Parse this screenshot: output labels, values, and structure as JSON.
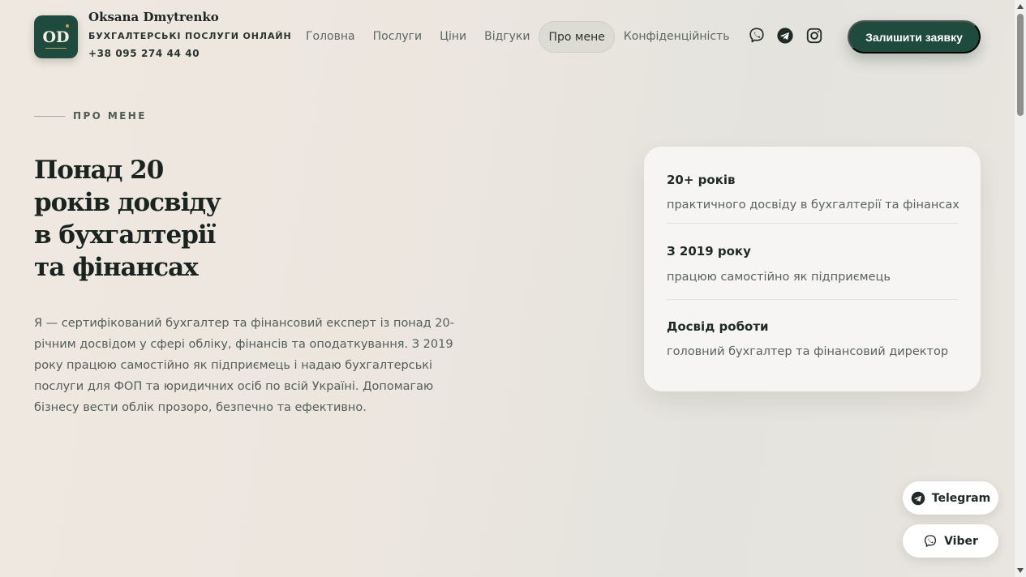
{
  "header": {
    "logo_text": "OD",
    "brand_name": "Oksana Dmytrenko",
    "brand_subtitle": "БУХГАЛТЕРСЬКІ ПОСЛУГИ ОНЛАЙН",
    "phone": "+38 095 274 44 40",
    "nav": [
      {
        "label": "Головна"
      },
      {
        "label": "Послуги"
      },
      {
        "label": "Ціни"
      },
      {
        "label": "Відгуки"
      },
      {
        "label": "Про мене",
        "active": true
      },
      {
        "label": "Конфіденційність"
      }
    ],
    "social_icons": [
      "viber-icon",
      "telegram-icon",
      "instagram-icon"
    ],
    "cta_label": "Залишити заявку"
  },
  "about": {
    "eyebrow": "ПРО МЕНЕ",
    "heading_lines": [
      "Понад 20",
      "років досвіду",
      "в бухгалтерії",
      "та фінансах"
    ],
    "paragraph": "Я — сертифікований бухгалтер та фінансовий експерт із понад 20-річним досвідом у сфері обліку, фінансів та оподаткування. З 2019 року працюю самостійно як підприємець і надаю бухгалтерські послуги для ФОП та юридичних осіб по всій Україні. Допомагаю бізнесу вести облік прозоро, безпечно та ефективно."
  },
  "stats": [
    {
      "title": "20+ років",
      "desc": "практичного досвіду в бухгалтерії та фінансах"
    },
    {
      "title": "З 2019 року",
      "desc": "працюю самостійно як підприємець"
    },
    {
      "title": "Досвід роботи",
      "desc": "головний бухгалтер та фінансовий директор"
    }
  ],
  "floating": {
    "telegram_label": "Telegram",
    "viber_label": "Viber"
  },
  "colors": {
    "accent": "#1f4a3e",
    "gold": "#c9a25a",
    "background": "#ebe6df"
  }
}
